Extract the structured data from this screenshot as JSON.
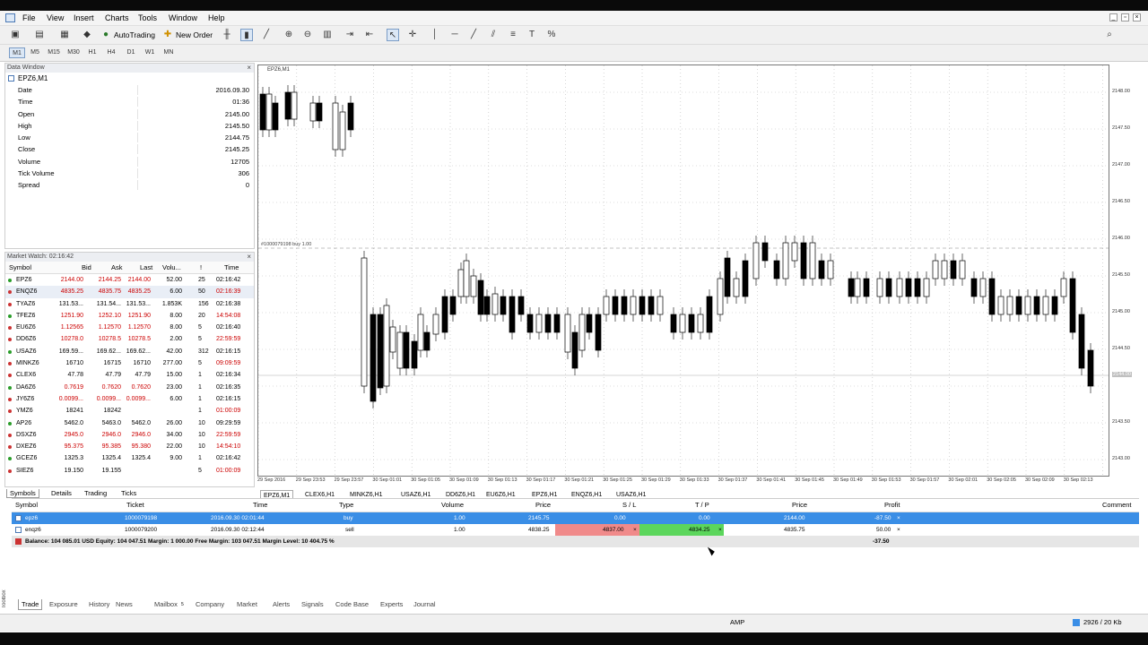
{
  "menu": [
    "File",
    "View",
    "Insert",
    "Charts",
    "Tools",
    "Window",
    "Help"
  ],
  "toolbar": {
    "autotrading": "AutoTrading",
    "new_order": "New Order"
  },
  "timeframes": [
    "M1",
    "M5",
    "M15",
    "M30",
    "H1",
    "H4",
    "D1",
    "W1",
    "MN"
  ],
  "data_window": {
    "title": "Data Window",
    "symbol": "EPZ6,M1",
    "rows": [
      {
        "k": "Date",
        "v": "2016.09.30"
      },
      {
        "k": "Time",
        "v": "01:36"
      },
      {
        "k": "Open",
        "v": "2145.00"
      },
      {
        "k": "High",
        "v": "2145.50"
      },
      {
        "k": "Low",
        "v": "2144.75"
      },
      {
        "k": "Close",
        "v": "2145.25"
      },
      {
        "k": "Volume",
        "v": "12705"
      },
      {
        "k": "Tick Volume",
        "v": "306"
      },
      {
        "k": "Spread",
        "v": "0"
      }
    ]
  },
  "market_watch": {
    "title": "Market Watch: 02:16:42",
    "headers": [
      "Symbol",
      "Bid",
      "Ask",
      "Last",
      "Volu...",
      "!",
      "Time"
    ],
    "rows": [
      {
        "s": "EPZ6",
        "bid": "2144.00",
        "ask": "2144.25",
        "last": "2144.00",
        "vol": "52.00",
        "n": "25",
        "t": "02:16:42",
        "c": "#cc0000",
        "tc": "#000"
      },
      {
        "s": "ENQZ6",
        "bid": "4835.25",
        "ask": "4835.75",
        "last": "4835.25",
        "vol": "6.00",
        "n": "50",
        "t": "02:16:39",
        "c": "#cc0000",
        "tc": "#cc0000",
        "hl": true
      },
      {
        "s": "TYAZ6",
        "bid": "131.53...",
        "ask": "131.54...",
        "last": "131.53...",
        "vol": "1.853K",
        "n": "156",
        "t": "02:16:38",
        "c": "#000",
        "tc": "#000"
      },
      {
        "s": "TFEZ6",
        "bid": "1251.90",
        "ask": "1252.10",
        "last": "1251.90",
        "vol": "8.00",
        "n": "20",
        "t": "14:54:08",
        "c": "#cc0000",
        "tc": "#cc0000"
      },
      {
        "s": "EU6Z6",
        "bid": "1.12565",
        "ask": "1.12570",
        "last": "1.12570",
        "vol": "8.00",
        "n": "5",
        "t": "02:16:40",
        "c": "#cc0000",
        "tc": "#000"
      },
      {
        "s": "DD6Z6",
        "bid": "10278.0",
        "ask": "10278.5",
        "last": "10278.5",
        "vol": "2.00",
        "n": "5",
        "t": "22:59:59",
        "c": "#cc0000",
        "tc": "#cc0000"
      },
      {
        "s": "USAZ6",
        "bid": "169.59...",
        "ask": "169.62...",
        "last": "169.62...",
        "vol": "42.00",
        "n": "312",
        "t": "02:16:15",
        "c": "#000",
        "tc": "#000"
      },
      {
        "s": "MINKZ6",
        "bid": "16710",
        "ask": "16715",
        "last": "16710",
        "vol": "277.00",
        "n": "5",
        "t": "09:09:59",
        "c": "#000",
        "tc": "#cc0000"
      },
      {
        "s": "CLEX6",
        "bid": "47.78",
        "ask": "47.79",
        "last": "47.79",
        "vol": "15.00",
        "n": "1",
        "t": "02:16:34",
        "c": "#000",
        "tc": "#000"
      },
      {
        "s": "DA6Z6",
        "bid": "0.7619",
        "ask": "0.7620",
        "last": "0.7620",
        "vol": "23.00",
        "n": "1",
        "t": "02:16:35",
        "c": "#cc0000",
        "tc": "#000"
      },
      {
        "s": "JY6Z6",
        "bid": "0.0099...",
        "ask": "0.0099...",
        "last": "0.0099...",
        "vol": "6.00",
        "n": "1",
        "t": "02:16:15",
        "c": "#cc0000",
        "tc": "#000"
      },
      {
        "s": "YMZ6",
        "bid": "18241",
        "ask": "18242",
        "last": "",
        "vol": "",
        "n": "1",
        "t": "01:00:09",
        "c": "#000",
        "tc": "#cc0000"
      },
      {
        "s": "AP26",
        "bid": "5462.0",
        "ask": "5463.0",
        "last": "5462.0",
        "vol": "26.00",
        "n": "10",
        "t": "09:29:59",
        "c": "#000",
        "tc": "#000"
      },
      {
        "s": "DSXZ6",
        "bid": "2945.0",
        "ask": "2946.0",
        "last": "2946.0",
        "vol": "34.00",
        "n": "10",
        "t": "22:59:59",
        "c": "#cc0000",
        "tc": "#cc0000"
      },
      {
        "s": "DXEZ6",
        "bid": "95.375",
        "ask": "95.385",
        "last": "95.380",
        "vol": "22.00",
        "n": "10",
        "t": "14:54:10",
        "c": "#cc0000",
        "tc": "#cc0000"
      },
      {
        "s": "GCEZ6",
        "bid": "1325.3",
        "ask": "1325.4",
        "last": "1325.4",
        "vol": "9.00",
        "n": "1",
        "t": "02:16:42",
        "c": "#000",
        "tc": "#000"
      },
      {
        "s": "SIEZ6",
        "bid": "19.150",
        "ask": "19.155",
        "last": "",
        "vol": "",
        "n": "5",
        "t": "01:00:09",
        "c": "#000",
        "tc": "#cc0000"
      }
    ],
    "tabs": [
      "Symbols",
      "Details",
      "Trading",
      "Ticks"
    ]
  },
  "chart": {
    "label": "EPZ6,M1",
    "order_label": "#1000079198 buy 1.00",
    "y_ticks": [
      "2148.00",
      "2147.50",
      "2147.00",
      "2146.50",
      "2146.00",
      "2145.50",
      "2145.00",
      "2144.50",
      "2144.00",
      "2143.50",
      "2143.00"
    ],
    "current_price": "2144.00",
    "x_ticks": [
      "29 Sep 2016",
      "29 Sep 23:53",
      "29 Sep 23:57",
      "30 Sep 01:01",
      "30 Sep 01:05",
      "30 Sep 01:09",
      "30 Sep 01:13",
      "30 Sep 01:17",
      "30 Sep 01:21",
      "30 Sep 01:25",
      "30 Sep 01:29",
      "30 Sep 01:33",
      "30 Sep 01:37",
      "30 Sep 01:41",
      "30 Sep 01:45",
      "30 Sep 01:49",
      "30 Sep 01:53",
      "30 Sep 01:57",
      "30 Sep 02:01",
      "30 Sep 02:05",
      "30 Sep 02:09",
      "30 Sep 02:13"
    ],
    "tabs": [
      "EPZ6,M1",
      "CLEX6,H1",
      "MINKZ6,H1",
      "USAZ6,H1",
      "DD6Z6,H1",
      "EU6Z6,H1",
      "EPZ6,H1",
      "ENQZ6,H1",
      "USAZ6,H1"
    ]
  },
  "trade": {
    "headers": [
      "Symbol",
      "Ticket",
      "Time",
      "Type",
      "Volume",
      "Price",
      "S / L",
      "T / P",
      "Price",
      "Profit",
      "Comment"
    ],
    "rows": [
      {
        "sym": "epz6",
        "ticket": "1000079198",
        "time": "2016.09.30 02:01:44",
        "type": "buy",
        "vol": "1.00",
        "price": "2145.75",
        "sl": "0.00",
        "tp": "0.00",
        "cur": "2144.00",
        "profit": "-87.50"
      },
      {
        "sym": "enqz6",
        "ticket": "1000079200",
        "time": "2016.09.30 02:12:44",
        "type": "sell",
        "vol": "1.00",
        "price": "4838.25",
        "sl": "4837.00",
        "tp": "4834.25",
        "cur": "4835.75",
        "profit": "50.00"
      }
    ],
    "balance": "Balance: 104 085.01 USD  Equity: 104 047.51  Margin: 1 000.00  Free Margin: 103 047.51  Margin Level: 10 404.75 %",
    "total": "-37.50"
  },
  "terminal_tabs": [
    "Trade",
    "Exposure",
    "History",
    "News",
    "Mailbox",
    "Company",
    "Market",
    "Alerts",
    "Signals",
    "Code Base",
    "Experts",
    "Journal"
  ],
  "mailbox_badge": "5",
  "toolbox_label": "Toolbox",
  "status": {
    "profile": "AMP",
    "traffic": "2926 / 20 Kb"
  }
}
